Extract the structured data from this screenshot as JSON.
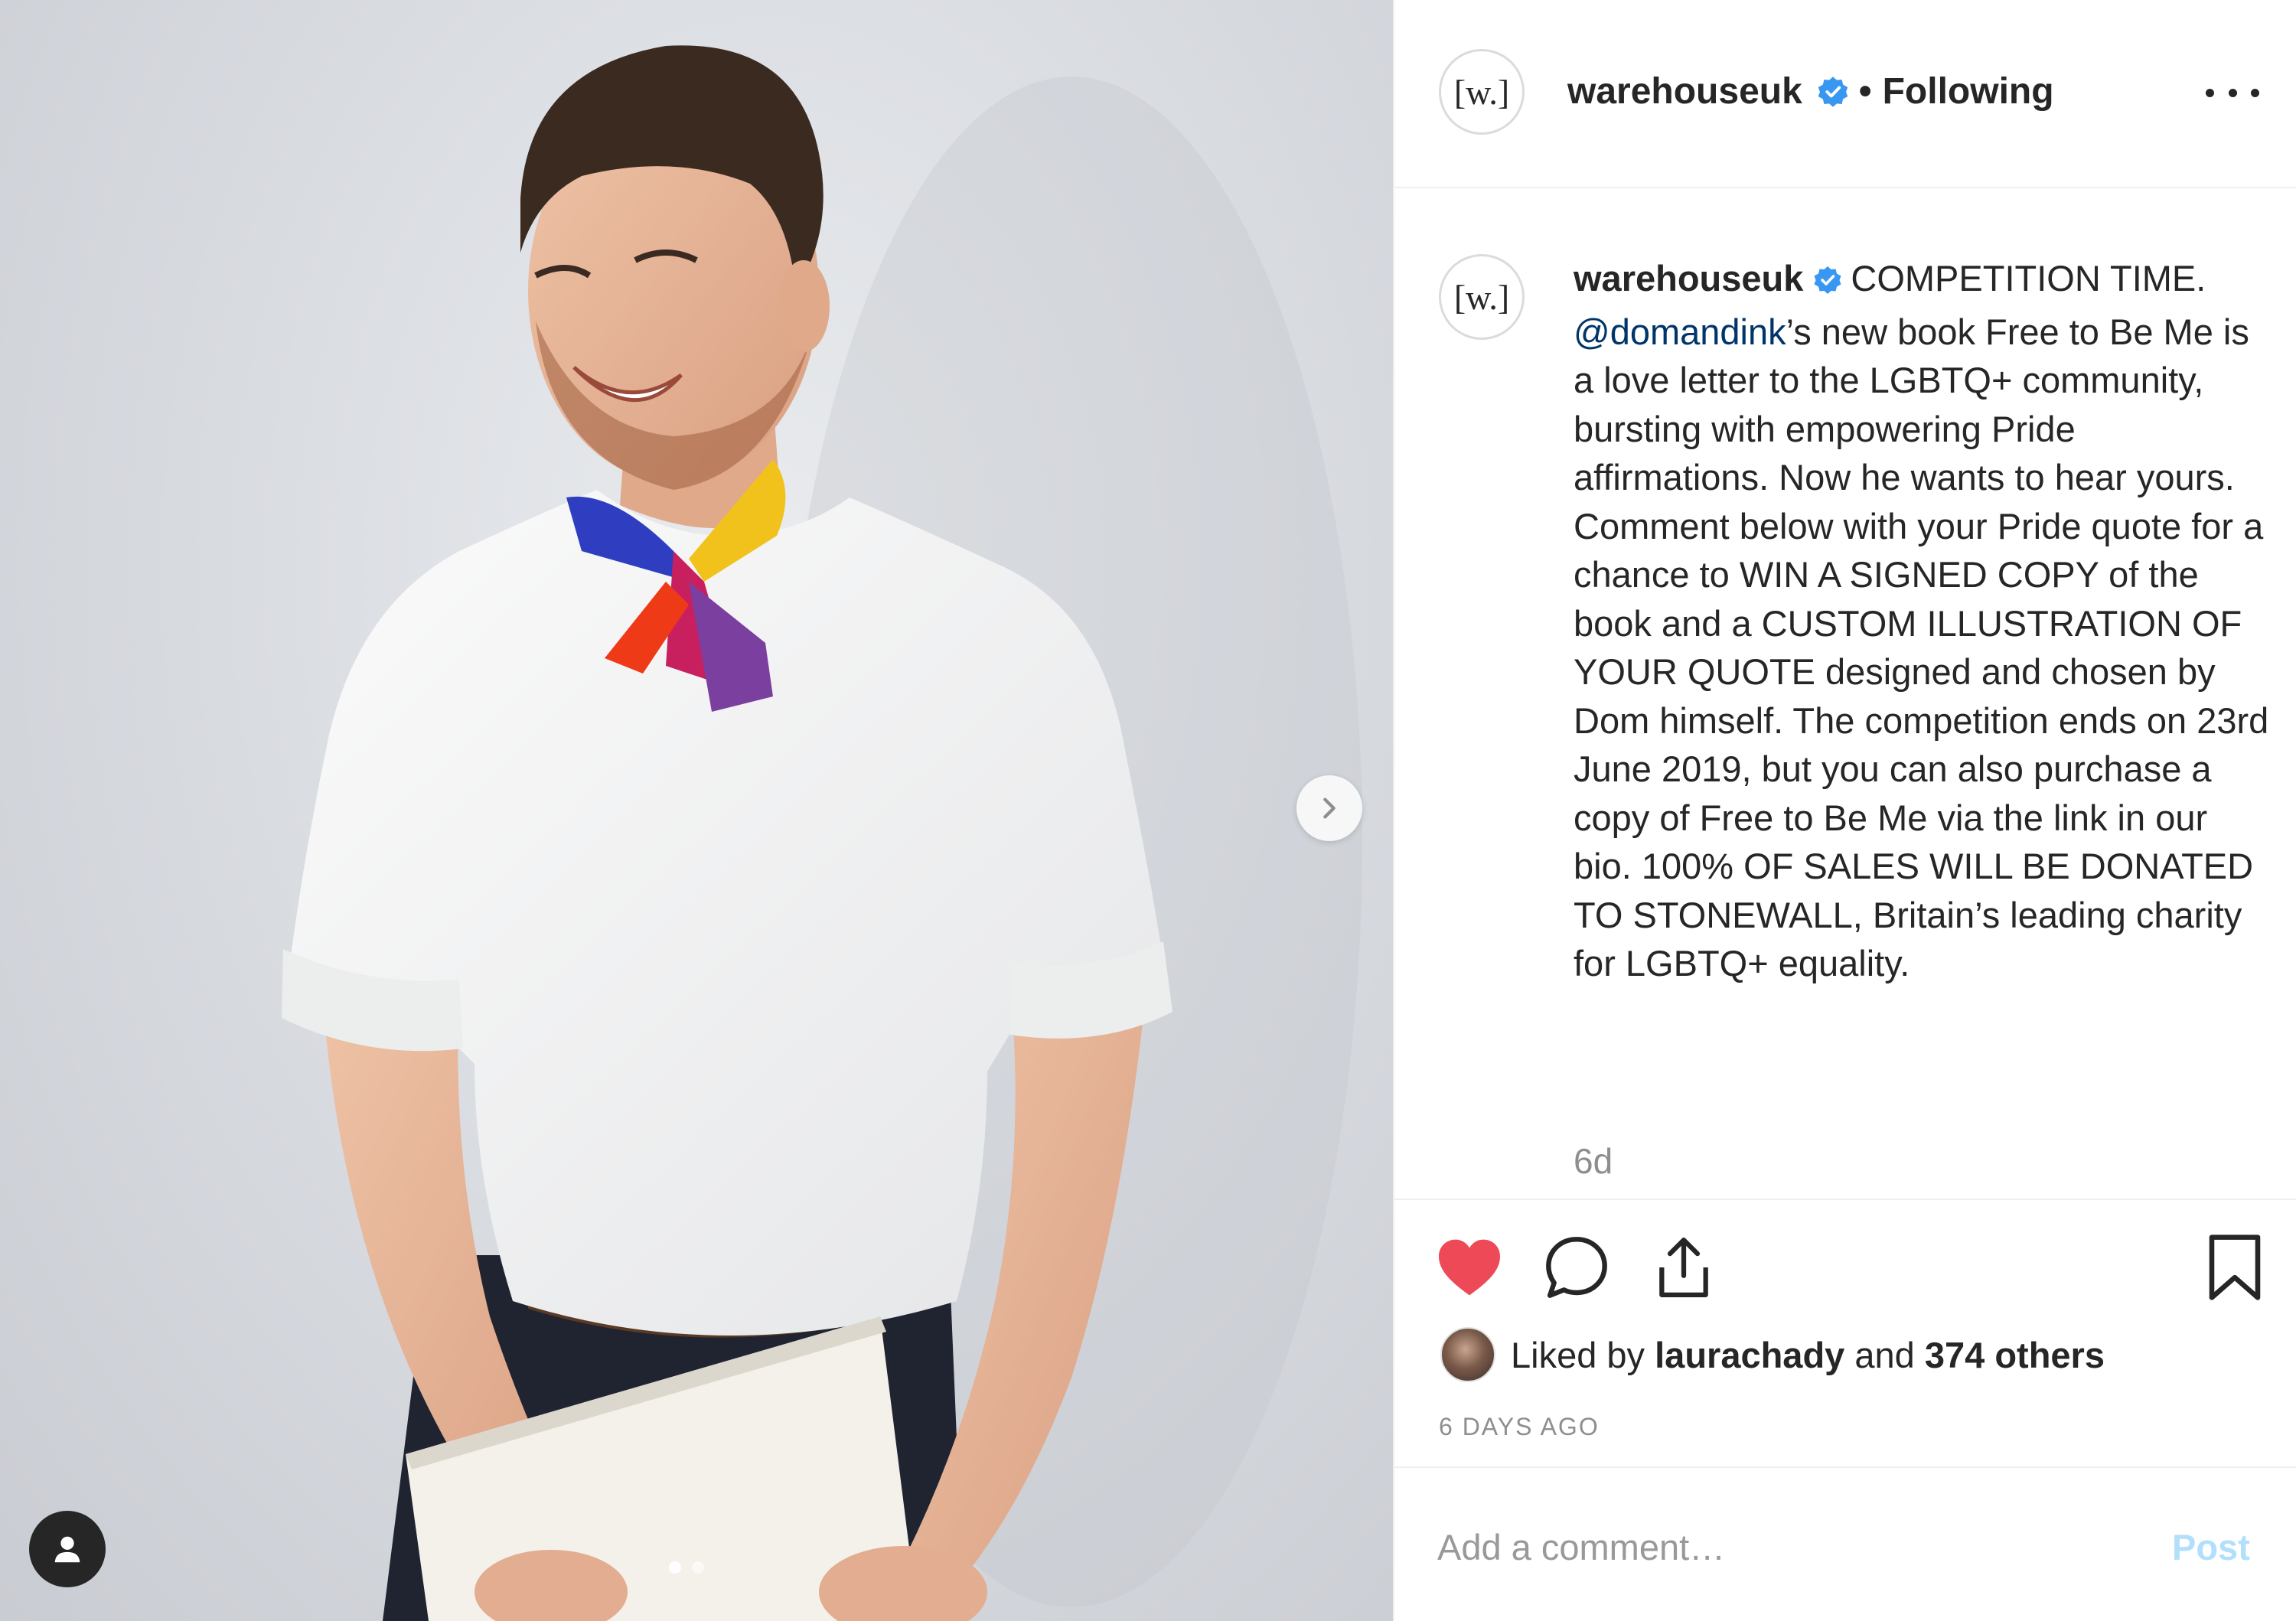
{
  "post": {
    "image": {
      "subject": "man-in-white-tshirt-with-rainbow-scarf",
      "slide_count": 2,
      "active_slide": 1,
      "next_icon": "chevron-right-icon",
      "tag_icon": "user-tag-icon"
    },
    "header": {
      "avatar_text": "[w.]",
      "username": "warehouseuk",
      "verified_icon": "verified-badge-icon",
      "separator": "•",
      "follow_status": "Following",
      "more_icon": "more-options-icon"
    },
    "caption": {
      "avatar_text": "[w.]",
      "username": "warehouseuk",
      "intro": "COMPETITION TIME.",
      "mention": "@domandink",
      "body": "’s new book Free to Be Me is a love letter to the LGBTQ+ community, bursting with empowering Pride affirmations. Now he wants to hear yours.\nComment below with your Pride quote for a chance to WIN A SIGNED COPY of the book and a CUSTOM ILLUSTRATION OF YOUR QUOTE designed and chosen by Dom himself. The competition ends on 23rd June 2019, but you can also purchase a copy of Free to Be Me via the link in our bio. 100% OF SALES WILL BE DONATED TO STONEWALL, Britain’s leading charity for LGBTQ+ equality.",
      "timestamp": "6d"
    },
    "actions": {
      "like_icon": "heart-filled-icon",
      "comment_icon": "comment-icon",
      "share_icon": "share-icon",
      "save_icon": "bookmark-icon",
      "like_color": "#ed4956"
    },
    "likes": {
      "prefix": "Liked by",
      "user": "laurachady",
      "conjunction": "and",
      "others": "374 others"
    },
    "date": "6 DAYS AGO",
    "comment": {
      "placeholder": "Add a comment…",
      "post_label": "Post",
      "post_color": "#b2dffc"
    }
  }
}
